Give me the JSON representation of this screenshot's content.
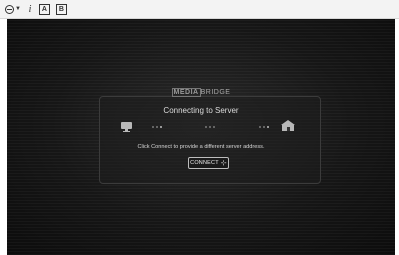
{
  "toolbar": {
    "buttons": [
      {
        "icon": "globe-icon",
        "has_dropdown": true
      },
      {
        "icon": "info-icon",
        "glyph": "i"
      },
      {
        "icon": "fit-window-icon",
        "glyph": "A"
      },
      {
        "icon": "fullscreen-icon",
        "glyph": "B"
      }
    ]
  },
  "app": {
    "logo_part1": "MEDIA",
    "logo_part2": "BRIDGE",
    "status_title": "Connecting to Server",
    "hint": "Click Connect to provide a different server address.",
    "connect_label": "CONNECT",
    "connect_icon": "plug-icon",
    "client_icon": "monitor-icon",
    "server_icon": "server-house-icon"
  },
  "colors": {
    "background": "#111111",
    "panel_border": "#3b3b3b",
    "text": "#dcdcdc",
    "toolbar": "#f3f3f3"
  }
}
